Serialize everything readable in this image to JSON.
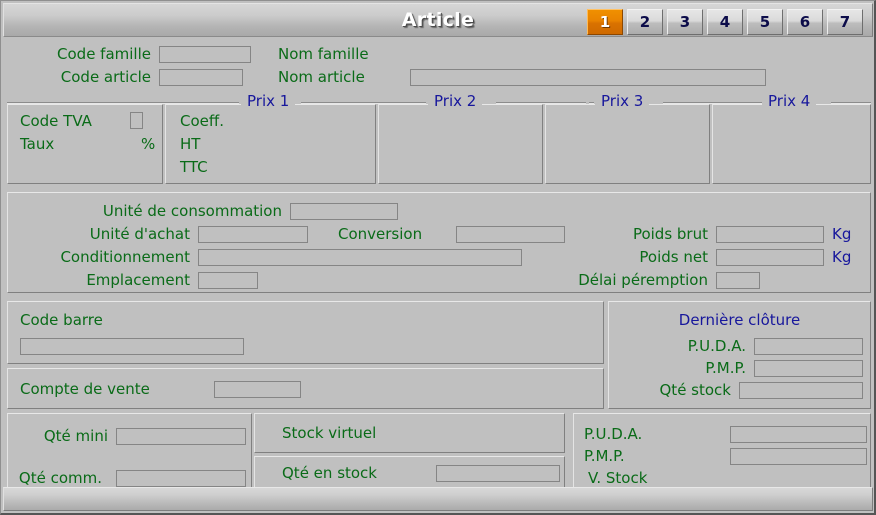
{
  "window": {
    "title": "Article"
  },
  "tabs": [
    {
      "label": "1",
      "active": true
    },
    {
      "label": "2",
      "active": false
    },
    {
      "label": "3",
      "active": false
    },
    {
      "label": "4",
      "active": false
    },
    {
      "label": "5",
      "active": false
    },
    {
      "label": "6",
      "active": false
    },
    {
      "label": "7",
      "active": false
    }
  ],
  "identity": {
    "code_famille_label": "Code famille",
    "code_famille_value": "",
    "nom_famille_label": "Nom famille",
    "nom_famille_value": "",
    "code_article_label": "Code article",
    "code_article_value": "",
    "nom_article_label": "Nom article",
    "nom_article_value": ""
  },
  "prix": {
    "groups": [
      {
        "label": "Prix 1"
      },
      {
        "label": "Prix 2"
      },
      {
        "label": "Prix 3"
      },
      {
        "label": "Prix 4"
      }
    ],
    "tva": {
      "code_tva_label": "Code TVA",
      "code_tva_value": "",
      "taux_label": "Taux",
      "taux_value": "",
      "percent_label": "%"
    },
    "rows": [
      {
        "label": "Coeff.",
        "value": ""
      },
      {
        "label": "HT",
        "value": ""
      },
      {
        "label": "TTC",
        "value": ""
      }
    ]
  },
  "units": {
    "unite_consommation_label": "Unité de consommation",
    "unite_consommation_value": "",
    "unite_achat_label": "Unité d'achat",
    "unite_achat_value": "",
    "conversion_label": "Conversion",
    "conversion_value": "",
    "conditionnement_label": "Conditionnement",
    "conditionnement_value": "",
    "emplacement_label": "Emplacement",
    "emplacement_value": "",
    "poids_brut_label": "Poids brut",
    "poids_brut_value": "",
    "poids_brut_unit": "Kg",
    "poids_net_label": "Poids net",
    "poids_net_value": "",
    "poids_net_unit": "Kg",
    "delai_peremption_label": "Délai péremption",
    "delai_peremption_value": ""
  },
  "codebarre": {
    "label": "Code barre",
    "value": ""
  },
  "compte": {
    "label": "Compte de vente",
    "value": ""
  },
  "cloture": {
    "title": "Dernière clôture",
    "puda_label": "P.U.D.A.",
    "puda_value": "",
    "pmp_label": "P.M.P.",
    "pmp_value": "",
    "qte_stock_label": "Qté stock",
    "qte_stock_value": ""
  },
  "stock": {
    "qte_mini_label": "Qté mini",
    "qte_mini_value": "",
    "qte_comm_label": "Qté comm.",
    "qte_comm_value": "",
    "stock_virtuel_label": "Stock virtuel",
    "stock_virtuel_value": "",
    "qte_en_stock_label": "Qté en stock",
    "qte_en_stock_value": "",
    "puda_label": "P.U.D.A.",
    "puda_value": "",
    "pmp_label": "P.M.P.",
    "pmp_value": "",
    "v_stock_label": "V. Stock",
    "v_stock_value": ""
  },
  "colors": {
    "label_green": "#0a6b18",
    "label_blue": "#17179c",
    "face": "#c0c0c0",
    "tab_active": "#e98300"
  }
}
